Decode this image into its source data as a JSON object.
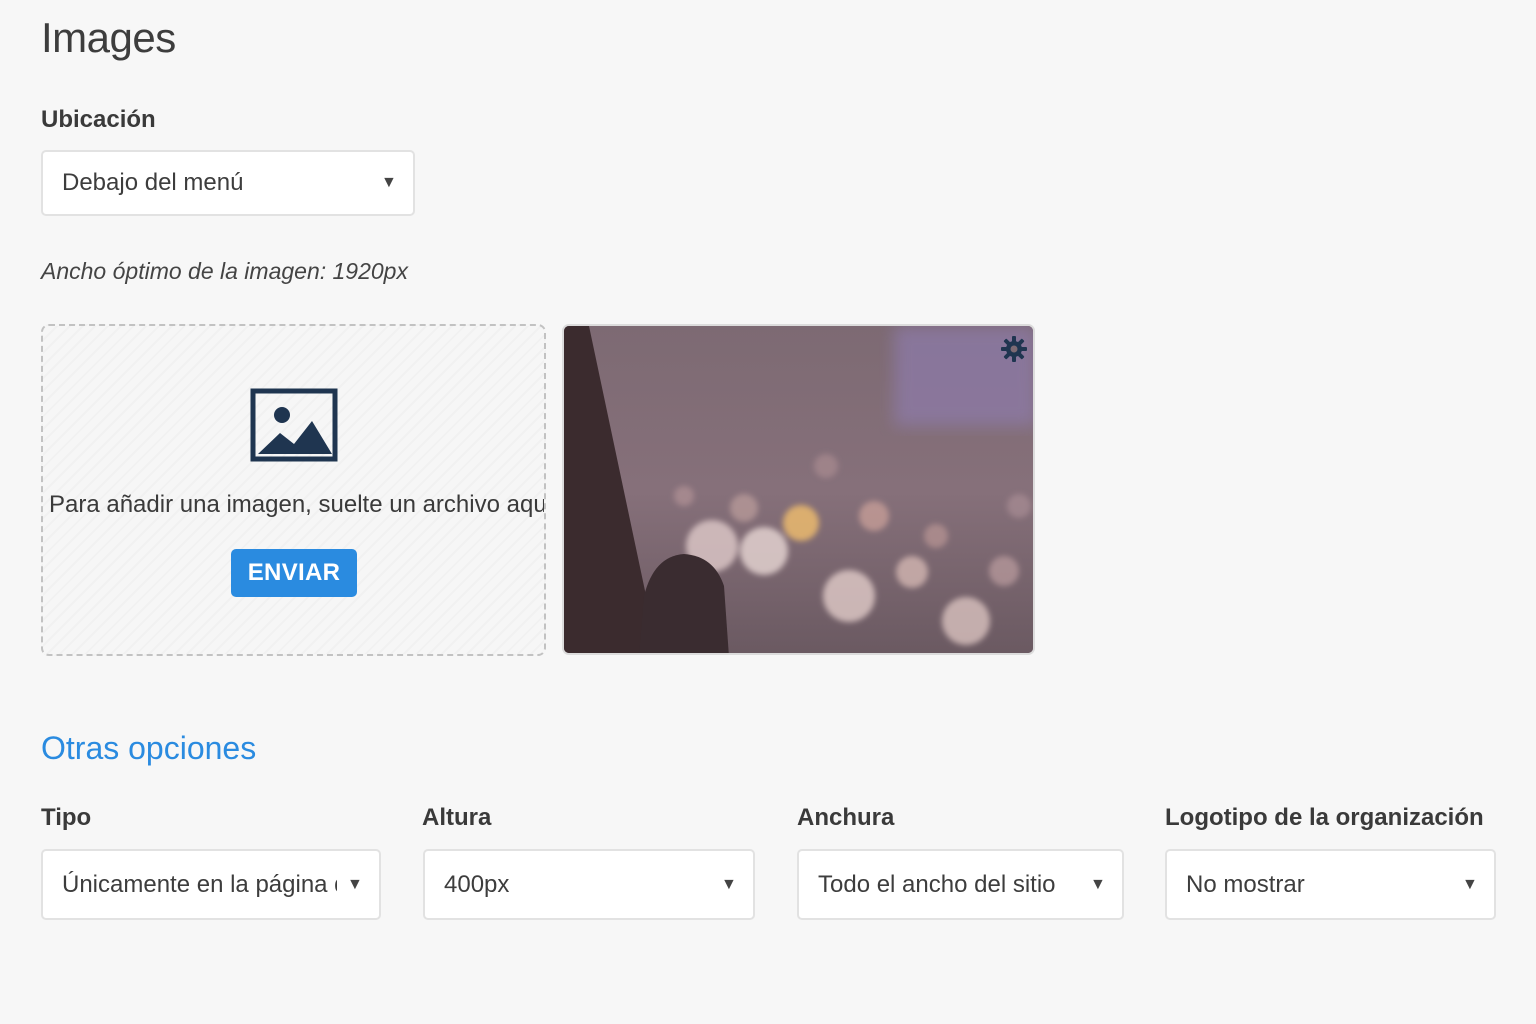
{
  "page": {
    "title": "Images"
  },
  "location": {
    "label": "Ubicación",
    "selected": "Debajo del menú"
  },
  "hint": "Ancho óptimo de la imagen: 1920px",
  "dropzone": {
    "text": "Para añadir una imagen, suelte un archivo aquí o",
    "button_label": "ENVIAR",
    "icon": "image-placeholder-icon"
  },
  "preview": {
    "settings_icon": "gear-icon"
  },
  "other_options": {
    "title": "Otras opciones",
    "fields": [
      {
        "label": "Tipo",
        "selected": "Únicamente en la página de"
      },
      {
        "label": "Altura",
        "selected": "400px"
      },
      {
        "label": "Anchura",
        "selected": "Todo el ancho del sitio"
      },
      {
        "label": "Logotipo de la organización",
        "selected": "No mostrar"
      }
    ]
  },
  "colors": {
    "accent": "#2a8be0",
    "background": "#f7f7f7",
    "icon_dark": "#1f3550"
  }
}
